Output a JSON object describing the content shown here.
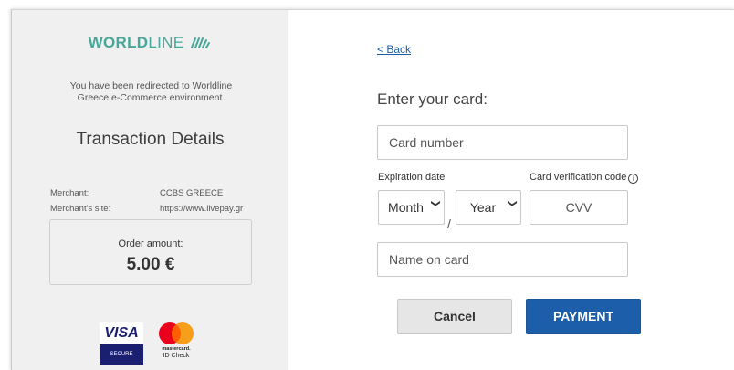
{
  "summary": {
    "logo_bold": "WORLD",
    "logo_light": "LINE",
    "redirect_line1": "You have been redirected to Worldline",
    "redirect_line2": "Greece e-Commerce environment.",
    "title": "Transaction Details",
    "merchant_label": "Merchant:",
    "merchant_value": "CCBS GREECE",
    "site_label": "Merchant's site:",
    "site_value": "https://www.livepay.gr",
    "order_label": "Order amount:",
    "order_amount": "5.00 €"
  },
  "badges": {
    "visa_top": "VISA",
    "visa_bottom": "SECURE",
    "mc_line1": "mastercard.",
    "mc_line2": "ID Check"
  },
  "form": {
    "back_link": "< Back",
    "heading": "Enter your card:",
    "card_number_placeholder": "Card number",
    "expiration_label": "Expiration date",
    "cvv_label": "Card verification code",
    "month_value": "Month",
    "year_value": "Year",
    "date_separator": "/",
    "cvv_placeholder": "CVV",
    "name_placeholder": "Name on card",
    "cancel_label": "Cancel",
    "payment_label": "PAYMENT"
  },
  "colors": {
    "brand_teal": "#46a79a",
    "primary_blue": "#1d5eaa",
    "panel_gray": "#f0f0f0"
  }
}
